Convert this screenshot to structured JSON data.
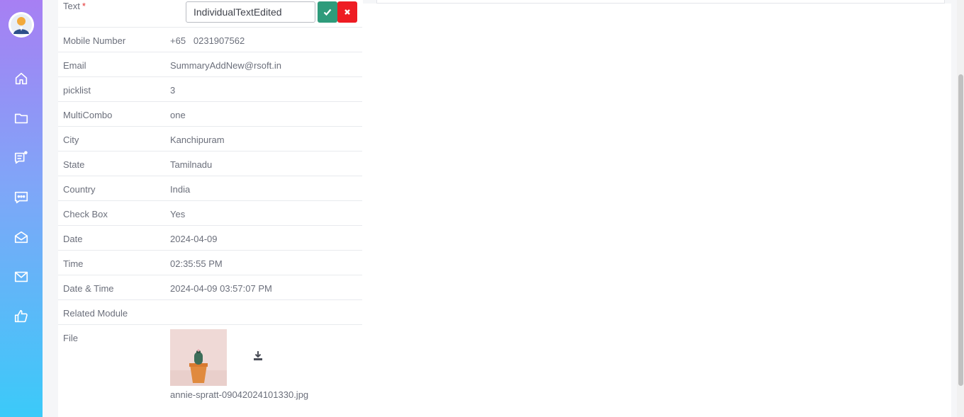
{
  "sidebar": {
    "items": [
      {
        "icon": "home-icon"
      },
      {
        "icon": "folder-icon"
      },
      {
        "icon": "notes-icon"
      },
      {
        "icon": "chat-icon"
      },
      {
        "icon": "mail-open-icon"
      },
      {
        "icon": "mail-icon"
      },
      {
        "icon": "thumbs-up-icon"
      }
    ],
    "gradient": [
      "#a77ff3",
      "#3bcaf9"
    ]
  },
  "form": {
    "text_field": {
      "label": "Text",
      "required_mark": "*",
      "value": "IndividualTextEdited"
    },
    "rows": [
      {
        "label": "Mobile Number",
        "value": "+65   0231907562"
      },
      {
        "label": "Email",
        "value": "SummaryAddNew@rsoft.in"
      },
      {
        "label": "picklist",
        "value": "3"
      },
      {
        "label": "MultiCombo",
        "value": "one"
      },
      {
        "label": "City",
        "value": "Kanchipuram"
      },
      {
        "label": "State",
        "value": "Tamilnadu"
      },
      {
        "label": "Country",
        "value": "India"
      },
      {
        "label": "Check Box",
        "value": "Yes"
      },
      {
        "label": "Date",
        "value": "2024-04-09"
      },
      {
        "label": "Time",
        "value": "02:35:55 PM"
      },
      {
        "label": "Date & Time",
        "value": "2024-04-09 03:57:07 PM"
      },
      {
        "label": "Related Module",
        "value": ""
      }
    ],
    "file": {
      "label": "File",
      "file_name": "annie-spratt-09042024101330.jpg"
    }
  },
  "colors": {
    "confirm": "#2e9b7b",
    "cancel": "#ee1c23",
    "required": "#e33232"
  }
}
